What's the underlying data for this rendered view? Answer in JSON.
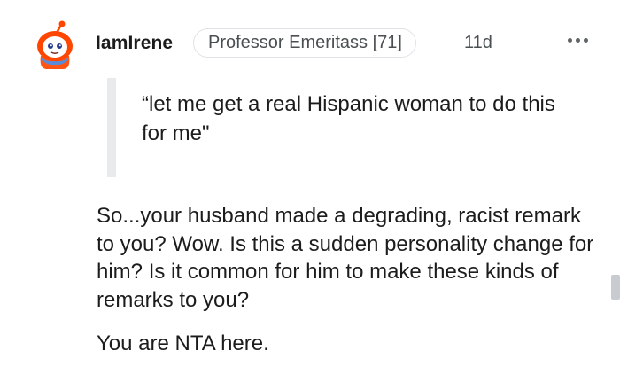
{
  "comment": {
    "author": "IamIrene",
    "flair": "Professor Emeritass [71]",
    "timestamp": "11d",
    "more_options_icon": "more-horizontal-icon",
    "avatar_icon": "snoo-avatar-icon",
    "quote": "“let me get a real Hispanic woman to do this for me\"",
    "body": "So...your husband made a degrading, racist remark to you? Wow. Is this a sudden personality change for him? Is it common for him to make these kinds of remarks to you?",
    "verdict": "You are NTA here."
  },
  "colors": {
    "text_primary": "#1c1c1c",
    "text_secondary": "#4a4f52",
    "avatar_orange": "#ff4500",
    "quote_bar": "#e8eaec"
  }
}
